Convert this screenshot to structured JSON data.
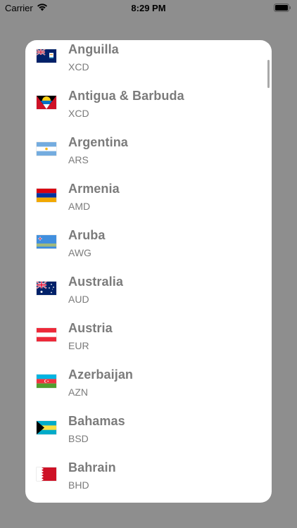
{
  "status_bar": {
    "carrier": "Carrier",
    "time": "8:29 PM"
  },
  "currencies": [
    {
      "country": "Anguilla",
      "code": "XCD",
      "flag": "anguilla-flag-icon"
    },
    {
      "country": "Antigua & Barbuda",
      "code": "XCD",
      "flag": "antigua-barbuda-flag-icon"
    },
    {
      "country": "Argentina",
      "code": "ARS",
      "flag": "argentina-flag-icon"
    },
    {
      "country": "Armenia",
      "code": "AMD",
      "flag": "armenia-flag-icon"
    },
    {
      "country": "Aruba",
      "code": "AWG",
      "flag": "aruba-flag-icon"
    },
    {
      "country": "Australia",
      "code": "AUD",
      "flag": "australia-flag-icon"
    },
    {
      "country": "Austria",
      "code": "EUR",
      "flag": "austria-flag-icon"
    },
    {
      "country": "Azerbaijan",
      "code": "AZN",
      "flag": "azerbaijan-flag-icon"
    },
    {
      "country": "Bahamas",
      "code": "BSD",
      "flag": "bahamas-flag-icon"
    },
    {
      "country": "Bahrain",
      "code": "BHD",
      "flag": "bahrain-flag-icon"
    }
  ],
  "colors": {
    "backdrop": "#8e8e8e",
    "sheet": "#ffffff",
    "text": "#7b7b7b"
  }
}
